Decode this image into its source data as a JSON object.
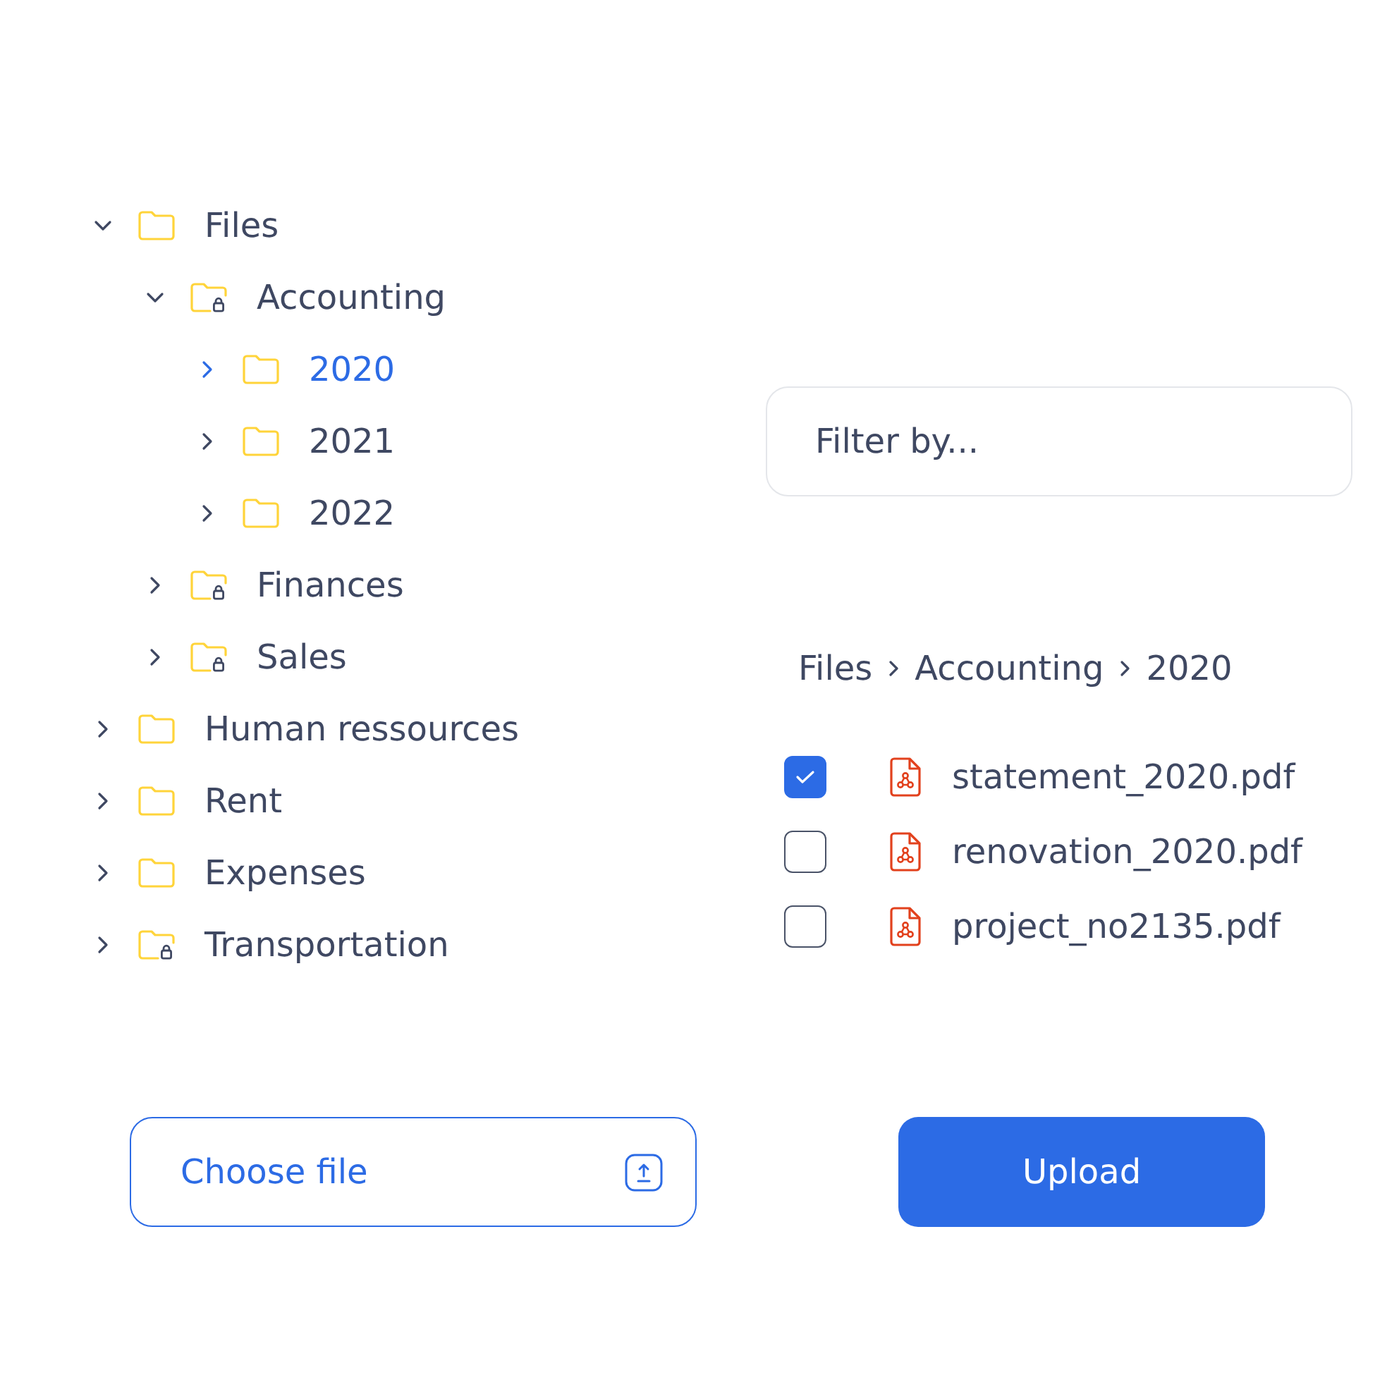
{
  "folder_tree": [
    {
      "label": "Files",
      "locked": false,
      "expanded": true,
      "selected": false,
      "children": [
        {
          "label": "Accounting",
          "locked": true,
          "expanded": true,
          "selected": false,
          "children": [
            {
              "label": "2020",
              "locked": false,
              "expanded": false,
              "selected": true
            },
            {
              "label": "2021",
              "locked": false,
              "expanded": false,
              "selected": false
            },
            {
              "label": "2022",
              "locked": false,
              "expanded": false,
              "selected": false
            }
          ]
        },
        {
          "label": "Finances",
          "locked": true,
          "expanded": false,
          "selected": false
        },
        {
          "label": "Sales",
          "locked": true,
          "expanded": false,
          "selected": false
        }
      ]
    },
    {
      "label": "Human ressources",
      "locked": false,
      "expanded": false,
      "selected": false
    },
    {
      "label": "Rent",
      "locked": false,
      "expanded": false,
      "selected": false
    },
    {
      "label": "Expenses",
      "locked": false,
      "expanded": false,
      "selected": false
    },
    {
      "label": "Transportation",
      "locked": true,
      "expanded": false,
      "selected": false
    }
  ],
  "filter": {
    "placeholder": "Filter by..."
  },
  "breadcrumb": [
    "Files",
    "Accounting",
    "2020"
  ],
  "files": [
    {
      "name": "statement_2020.pdf",
      "checked": true
    },
    {
      "name": "renovation_2020.pdf",
      "checked": false
    },
    {
      "name": "project_no2135.pdf",
      "checked": false
    }
  ],
  "choose_file_button": {
    "label": "Choose file"
  },
  "upload_button": {
    "label": "Upload"
  }
}
